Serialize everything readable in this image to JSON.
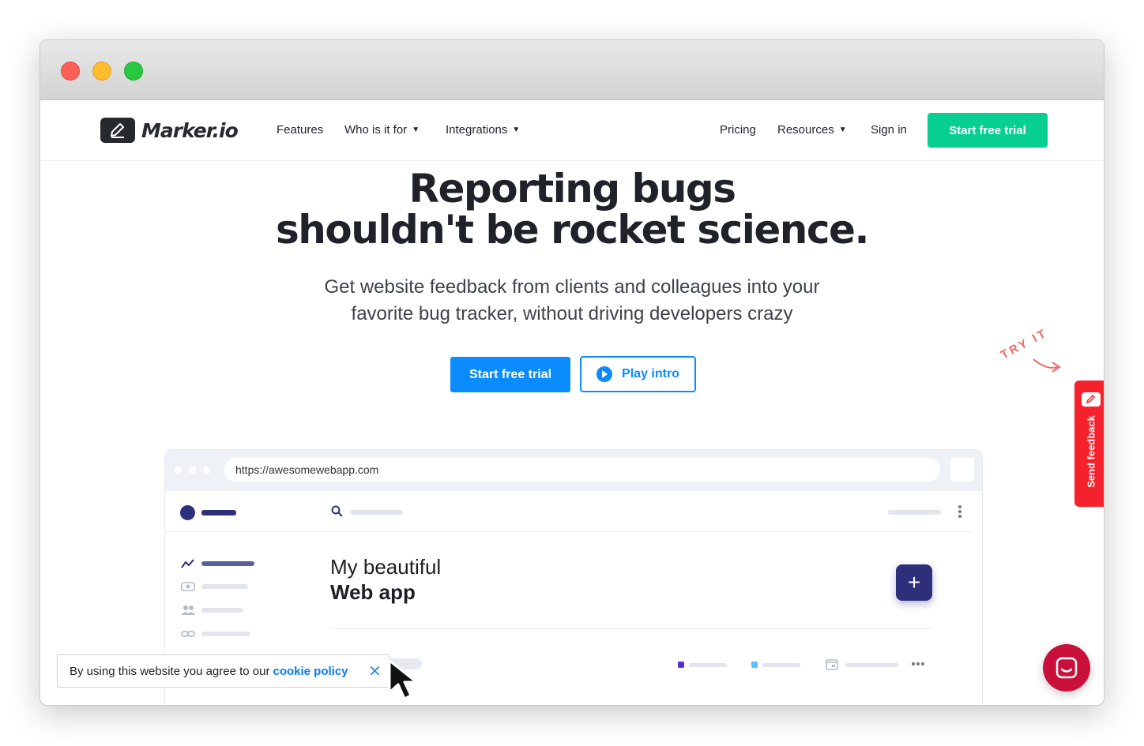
{
  "brand": {
    "name": "Marker.io"
  },
  "nav": {
    "left": [
      {
        "label": "Features"
      },
      {
        "label": "Who is it for"
      },
      {
        "label": "Integrations"
      }
    ],
    "right": [
      {
        "label": "Pricing"
      },
      {
        "label": "Resources"
      },
      {
        "label": "Sign in"
      }
    ],
    "cta": "Start free trial"
  },
  "hero": {
    "title_line1": "Reporting bugs",
    "title_line2": "shouldn't be rocket science.",
    "subtitle_line1": "Get website feedback from clients and colleagues into your",
    "subtitle_line2": "favorite bug tracker, without driving developers crazy",
    "primary_button": "Start free trial",
    "secondary_button": "Play intro"
  },
  "feedback_widget": {
    "hint": "TRY IT",
    "label": "Send feedback"
  },
  "mockup": {
    "url": "https://awesomewebapp.com",
    "title_line1": "My beautiful",
    "title_line2": "Web app",
    "add_symbol": "+"
  },
  "cookie": {
    "text": "By using this website you agree to our",
    "link": "cookie policy",
    "close": "✕"
  },
  "colors": {
    "cta_green": "#07cf91",
    "primary_blue": "#0a8cff",
    "feedback_red": "#f5222d",
    "mock_navy": "#2d2f7a",
    "chat_crimson": "#c8103b"
  }
}
